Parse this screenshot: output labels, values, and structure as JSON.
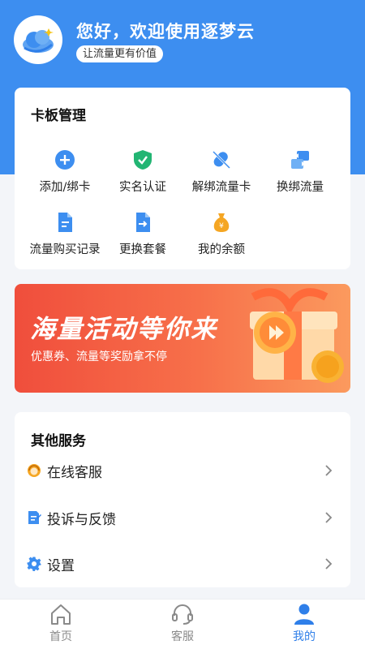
{
  "header": {
    "greeting": "您好，欢迎使用逐梦云",
    "slogan": "让流量更有价值"
  },
  "card_management": {
    "title": "卡板管理",
    "items": [
      {
        "label": "添加/绑卡",
        "icon": "plus-circle-icon"
      },
      {
        "label": "实名认证",
        "icon": "shield-check-icon"
      },
      {
        "label": "解绑流量卡",
        "icon": "unlink-icon"
      },
      {
        "label": "换绑流量",
        "icon": "swap-icon"
      },
      {
        "label": "流量购买记录",
        "icon": "document-icon"
      },
      {
        "label": "更换套餐",
        "icon": "exchange-document-icon"
      },
      {
        "label": "我的余额",
        "icon": "money-bag-icon"
      }
    ]
  },
  "banner": {
    "title": "海量活动等你来",
    "subtitle": "优惠券、流量等奖励拿不停"
  },
  "other_services": {
    "title": "其他服务",
    "items": [
      {
        "label": "在线客服",
        "icon": "customer-service-icon"
      },
      {
        "label": "投诉与反馈",
        "icon": "feedback-icon"
      },
      {
        "label": "设置",
        "icon": "gear-icon"
      }
    ]
  },
  "tabbar": {
    "tabs": [
      {
        "label": "首页",
        "icon": "home-icon"
      },
      {
        "label": "客服",
        "icon": "headset-icon"
      },
      {
        "label": "我的",
        "icon": "user-icon",
        "active": true
      }
    ]
  },
  "colors": {
    "primary": "#3d8ef0",
    "accent_blue": "#2f7fe9",
    "green": "#22b573",
    "orange": "#f5a623",
    "banner_red": "#f04e3c"
  }
}
